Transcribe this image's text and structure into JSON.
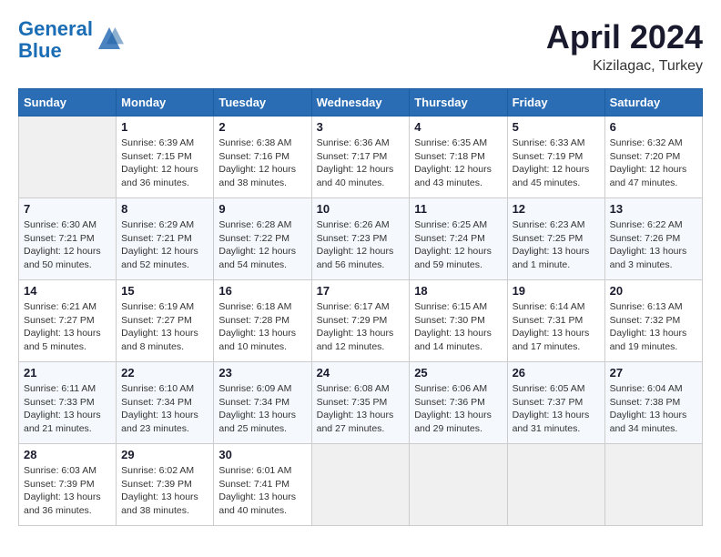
{
  "header": {
    "logo_line1": "General",
    "logo_line2": "Blue",
    "month": "April 2024",
    "location": "Kizilagac, Turkey"
  },
  "weekdays": [
    "Sunday",
    "Monday",
    "Tuesday",
    "Wednesday",
    "Thursday",
    "Friday",
    "Saturday"
  ],
  "weeks": [
    [
      {
        "day": "",
        "empty": true
      },
      {
        "day": "1",
        "sunrise": "6:39 AM",
        "sunset": "7:15 PM",
        "daylight": "12 hours and 36 minutes."
      },
      {
        "day": "2",
        "sunrise": "6:38 AM",
        "sunset": "7:16 PM",
        "daylight": "12 hours and 38 minutes."
      },
      {
        "day": "3",
        "sunrise": "6:36 AM",
        "sunset": "7:17 PM",
        "daylight": "12 hours and 40 minutes."
      },
      {
        "day": "4",
        "sunrise": "6:35 AM",
        "sunset": "7:18 PM",
        "daylight": "12 hours and 43 minutes."
      },
      {
        "day": "5",
        "sunrise": "6:33 AM",
        "sunset": "7:19 PM",
        "daylight": "12 hours and 45 minutes."
      },
      {
        "day": "6",
        "sunrise": "6:32 AM",
        "sunset": "7:20 PM",
        "daylight": "12 hours and 47 minutes."
      }
    ],
    [
      {
        "day": "7",
        "sunrise": "6:30 AM",
        "sunset": "7:21 PM",
        "daylight": "12 hours and 50 minutes."
      },
      {
        "day": "8",
        "sunrise": "6:29 AM",
        "sunset": "7:21 PM",
        "daylight": "12 hours and 52 minutes."
      },
      {
        "day": "9",
        "sunrise": "6:28 AM",
        "sunset": "7:22 PM",
        "daylight": "12 hours and 54 minutes."
      },
      {
        "day": "10",
        "sunrise": "6:26 AM",
        "sunset": "7:23 PM",
        "daylight": "12 hours and 56 minutes."
      },
      {
        "day": "11",
        "sunrise": "6:25 AM",
        "sunset": "7:24 PM",
        "daylight": "12 hours and 59 minutes."
      },
      {
        "day": "12",
        "sunrise": "6:23 AM",
        "sunset": "7:25 PM",
        "daylight": "13 hours and 1 minute."
      },
      {
        "day": "13",
        "sunrise": "6:22 AM",
        "sunset": "7:26 PM",
        "daylight": "13 hours and 3 minutes."
      }
    ],
    [
      {
        "day": "14",
        "sunrise": "6:21 AM",
        "sunset": "7:27 PM",
        "daylight": "13 hours and 5 minutes."
      },
      {
        "day": "15",
        "sunrise": "6:19 AM",
        "sunset": "7:27 PM",
        "daylight": "13 hours and 8 minutes."
      },
      {
        "day": "16",
        "sunrise": "6:18 AM",
        "sunset": "7:28 PM",
        "daylight": "13 hours and 10 minutes."
      },
      {
        "day": "17",
        "sunrise": "6:17 AM",
        "sunset": "7:29 PM",
        "daylight": "13 hours and 12 minutes."
      },
      {
        "day": "18",
        "sunrise": "6:15 AM",
        "sunset": "7:30 PM",
        "daylight": "13 hours and 14 minutes."
      },
      {
        "day": "19",
        "sunrise": "6:14 AM",
        "sunset": "7:31 PM",
        "daylight": "13 hours and 17 minutes."
      },
      {
        "day": "20",
        "sunrise": "6:13 AM",
        "sunset": "7:32 PM",
        "daylight": "13 hours and 19 minutes."
      }
    ],
    [
      {
        "day": "21",
        "sunrise": "6:11 AM",
        "sunset": "7:33 PM",
        "daylight": "13 hours and 21 minutes."
      },
      {
        "day": "22",
        "sunrise": "6:10 AM",
        "sunset": "7:34 PM",
        "daylight": "13 hours and 23 minutes."
      },
      {
        "day": "23",
        "sunrise": "6:09 AM",
        "sunset": "7:34 PM",
        "daylight": "13 hours and 25 minutes."
      },
      {
        "day": "24",
        "sunrise": "6:08 AM",
        "sunset": "7:35 PM",
        "daylight": "13 hours and 27 minutes."
      },
      {
        "day": "25",
        "sunrise": "6:06 AM",
        "sunset": "7:36 PM",
        "daylight": "13 hours and 29 minutes."
      },
      {
        "day": "26",
        "sunrise": "6:05 AM",
        "sunset": "7:37 PM",
        "daylight": "13 hours and 31 minutes."
      },
      {
        "day": "27",
        "sunrise": "6:04 AM",
        "sunset": "7:38 PM",
        "daylight": "13 hours and 34 minutes."
      }
    ],
    [
      {
        "day": "28",
        "sunrise": "6:03 AM",
        "sunset": "7:39 PM",
        "daylight": "13 hours and 36 minutes."
      },
      {
        "day": "29",
        "sunrise": "6:02 AM",
        "sunset": "7:39 PM",
        "daylight": "13 hours and 38 minutes."
      },
      {
        "day": "30",
        "sunrise": "6:01 AM",
        "sunset": "7:41 PM",
        "daylight": "13 hours and 40 minutes."
      },
      {
        "day": "",
        "empty": true
      },
      {
        "day": "",
        "empty": true
      },
      {
        "day": "",
        "empty": true
      },
      {
        "day": "",
        "empty": true
      }
    ]
  ]
}
